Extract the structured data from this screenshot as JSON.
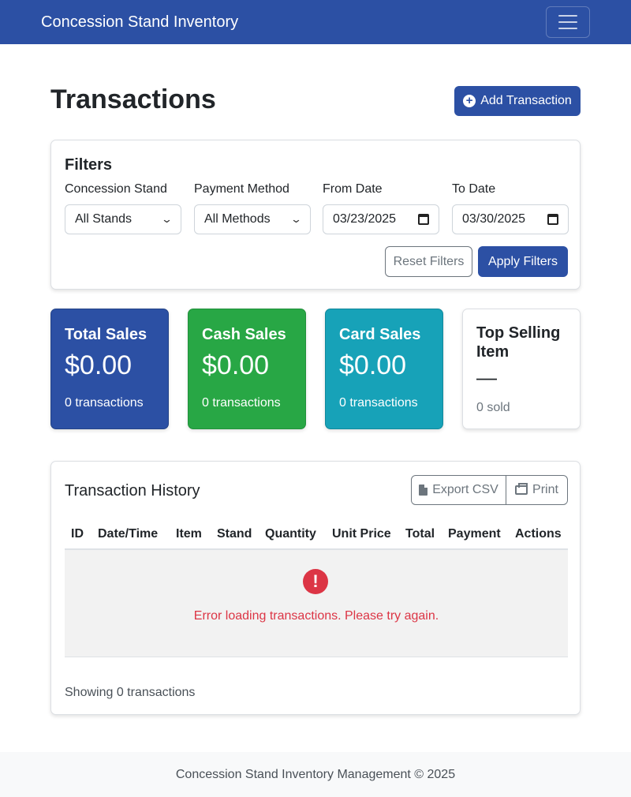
{
  "navbar": {
    "brand": "Concession Stand Inventory",
    "toggle_icon": "hamburger-menu-icon"
  },
  "header": {
    "title": "Transactions",
    "add_button": "Add Transaction",
    "add_icon": "plus-circle-icon"
  },
  "filters": {
    "title": "Filters",
    "stand_label": "Concession Stand",
    "stand_value": "All Stands",
    "payment_label": "Payment Method",
    "payment_value": "All Methods",
    "from_label": "From Date",
    "from_value": "03/23/2025",
    "to_label": "To Date",
    "to_value": "03/30/2025",
    "reset_button": "Reset Filters",
    "apply_button": "Apply Filters"
  },
  "stats": {
    "total": {
      "title": "Total Sales",
      "value": "$0.00",
      "sub": "0 transactions",
      "color": "#2c50a4"
    },
    "cash": {
      "title": "Cash Sales",
      "value": "$0.00",
      "sub": "0 transactions",
      "color": "#28a745"
    },
    "card": {
      "title": "Card Sales",
      "value": "$0.00",
      "sub": "0 transactions",
      "color": "#17a2b8"
    },
    "top": {
      "title": "Top Selling Item",
      "value": "—",
      "sub": "0 sold"
    }
  },
  "history": {
    "title": "Transaction History",
    "export_button": "Export CSV",
    "print_button": "Print",
    "columns": [
      "ID",
      "Date/Time",
      "Item",
      "Stand",
      "Quantity",
      "Unit Price",
      "Total",
      "Payment",
      "Actions"
    ],
    "error_icon": "exclamation-circle-icon",
    "error_message": "Error loading transactions. Please try again.",
    "showing": "Showing 0 transactions"
  },
  "footer": {
    "text": "Concession Stand Inventory Management © 2025"
  },
  "colors": {
    "primary": "#2c50a4",
    "success": "#28a745",
    "info": "#17a2b8",
    "danger": "#dc3545"
  }
}
